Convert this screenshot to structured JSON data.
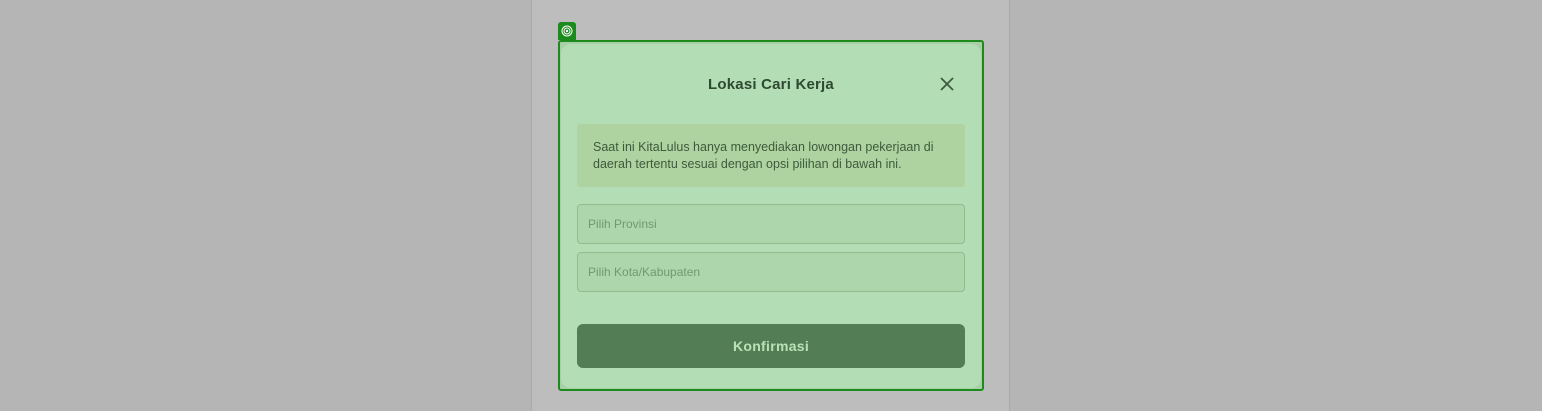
{
  "modal": {
    "title": "Lokasi Cari Kerja",
    "info_text": "Saat ini KitaLulus hanya menyediakan lowongan pekerjaan di daerah tertentu sesuai dengan opsi pilihan di bawah ini.",
    "province_field": {
      "placeholder": "Pilih Provinsi",
      "value": ""
    },
    "city_field": {
      "placeholder": "Pilih Kota/Kabupaten",
      "value": ""
    },
    "confirm_label": "Konfirmasi",
    "close_icon": "close-icon"
  },
  "overlay": {
    "target_icon": "target-icon",
    "highlight_color": "#1c8a1c"
  },
  "colors": {
    "modal_bg": "#b3ddb5",
    "button_bg": "#537d55",
    "button_text": "#b9e2b7",
    "title_text": "#2e4a30"
  }
}
